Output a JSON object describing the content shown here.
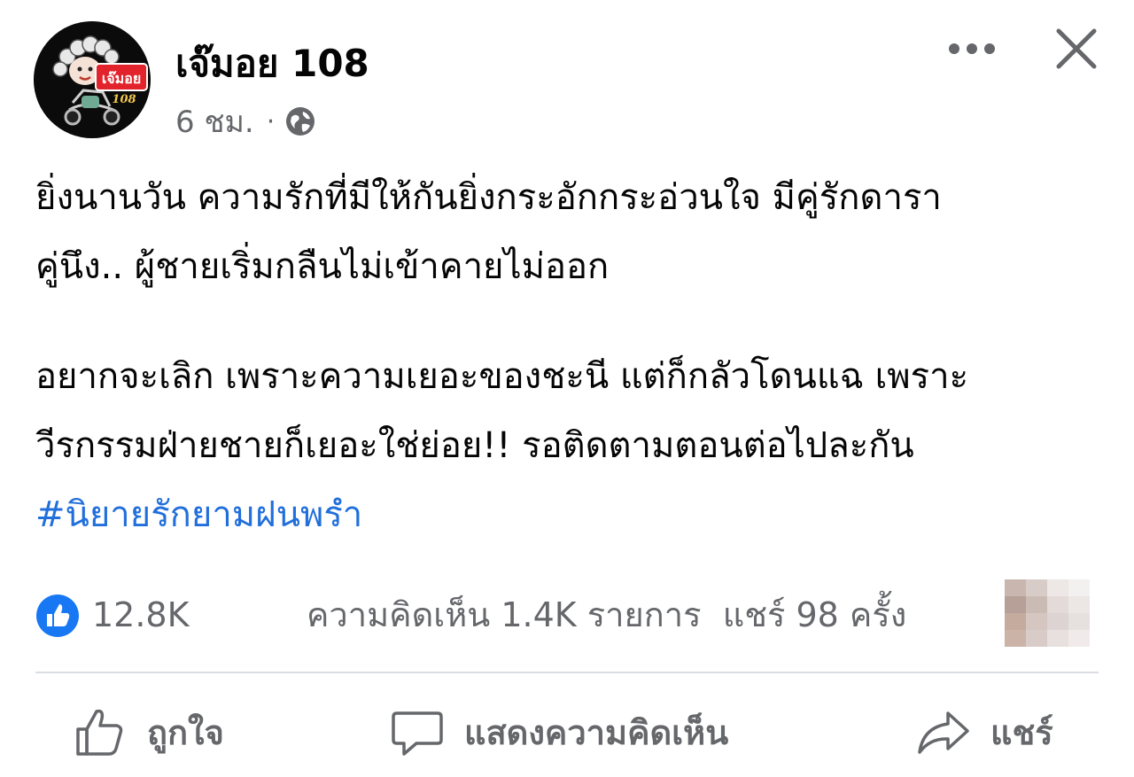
{
  "post": {
    "author": {
      "name": "เจ๊มอย 108",
      "avatar_text": "เจ๊มอย",
      "avatar_subtext": "108"
    },
    "timestamp": "6 ชม.",
    "separator": "·",
    "privacy_icon": "globe-icon",
    "menu_icon": "more-horizontal-icon",
    "close_icon": "close-icon",
    "body": {
      "paragraph1": [
        "ยิ่งนานวัน ความรักที่มีให้กันยิ่งกระอักกระอ่วนใจ มีคู่รักดารา",
        "คู่นึง.. ผู้ชายเริ่มกลืนไม่เข้าคายไม่ออก"
      ],
      "paragraph2": [
        "อยากจะเลิก เพราะความเยอะของชะนี แต่ก็กลัวโดนแฉ เพราะ",
        "วีรกรรมฝ่ายชายก็เยอะใช่ย่อย!! รอติดตามตอนต่อไปละกัน"
      ],
      "hashtag": "#นิยายรักยามฝนพรำ"
    },
    "stats": {
      "reaction_icon": "like-reaction-icon",
      "reactions": "12.8K",
      "comments": "ความคิดเห็น 1.4K รายการ",
      "shares": "แชร์ 98 ครั้ง"
    },
    "actions": {
      "like_label": "ถูกใจ",
      "comment_label": "แสดงความคิดเห็น",
      "share_label": "แชร์"
    }
  },
  "colors": {
    "text_primary": "#050505",
    "text_secondary": "#65676b",
    "hashtag": "#216fdb",
    "like_blue": "#1877f2",
    "divider": "#dadde1",
    "avatar_bg": "#0b0b0b",
    "avatar_text_red": "#e3232b"
  }
}
